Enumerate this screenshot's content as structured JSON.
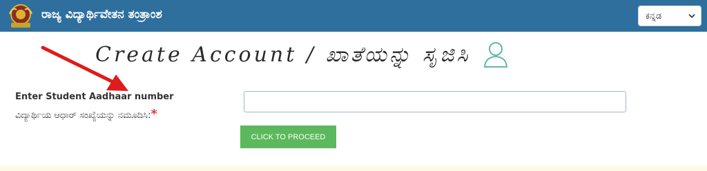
{
  "header": {
    "title": "ರಾಜ್ಯ ವಿದ್ಯಾರ್ಥಿವೇತನ ತಂತ್ರಾಂಶ",
    "emblem_icon": "karnataka-emblem-icon",
    "language_select": {
      "selected": "ಕನ್ನಡ",
      "icon": "chevron-down-icon"
    }
  },
  "main": {
    "heading": "Create Account / ಖಾತೆಯನ್ನು ಸೃಜಿಸಿ",
    "heading_icon": "user-outline-icon",
    "annotation_icon": "red-arrow-icon",
    "aadhaar": {
      "label_en": "Enter Student Aadhaar number",
      "label_kn": "ವಿದ್ಯಾರ್ಥಿಯ ಆಧಾರ್ ಸಂಖ್ಯೆಯನ್ನು ನಮೂದಿಸಿ:",
      "required_mark": "*",
      "value": ""
    },
    "proceed_button": "CLICK TO PROCEED"
  },
  "colors": {
    "topbar": "#2e6f9e",
    "button": "#5cb85c",
    "required": "#e53935",
    "arrow": "#e01b1b",
    "user_icon": "#5fb9a6",
    "bottom_strip": "#fdf9e4"
  }
}
